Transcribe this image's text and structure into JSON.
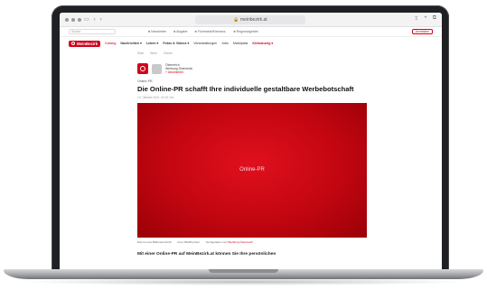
{
  "browser": {
    "url": "meinbezirk.at"
  },
  "site": {
    "search_placeholder": "Suche",
    "top_links": [
      "Newsletter",
      "Abgabe",
      "Flohmarkt/Kleinanz.",
      "Regionalgebiet"
    ],
    "login_label": "Anmelden",
    "logo_text": "MeinBezirk",
    "nav_items": [
      {
        "label": "Katalog",
        "style": "red"
      },
      {
        "label": "Nachrichten ▾",
        "style": "bold"
      },
      {
        "label": "Leben ▾",
        "style": "bold"
      },
      {
        "label": "Fotos & Videos ▾",
        "style": "bold"
      },
      {
        "label": "Veranstaltungen",
        "style": "normal"
      },
      {
        "label": "Jobs",
        "style": "normal"
      },
      {
        "label": "Marktplatz",
        "style": "normal"
      },
      {
        "label": "Kleinanzeig ▾",
        "style": "red"
      }
    ],
    "breadcrumbs": [
      "Start",
      "Wien",
      "Online"
    ]
  },
  "article": {
    "author_org": "Österreich",
    "author_name": "Werbung Österreich",
    "follow_label": "+ Abonnieren",
    "kicker": "Online-PR",
    "title": "Die Online-PR schafft Ihre individuelle gestaltbare Werbebotschaft",
    "meta": "13. Oktober 2021, 00:01 Uhr",
    "hero_label": "Online-PR",
    "captions": [
      "Das ist eine Bildunterschrift",
      "Foto: Bild/Symbol",
      "hochgeladen von"
    ],
    "caption_link": "Werbung Österreich",
    "lead": "Mit einer Online-PR auf MeinBezirk.at können Sie Ihre persönlichen"
  },
  "colors": {
    "brand": "#d0021b",
    "device": "#1f2023"
  }
}
